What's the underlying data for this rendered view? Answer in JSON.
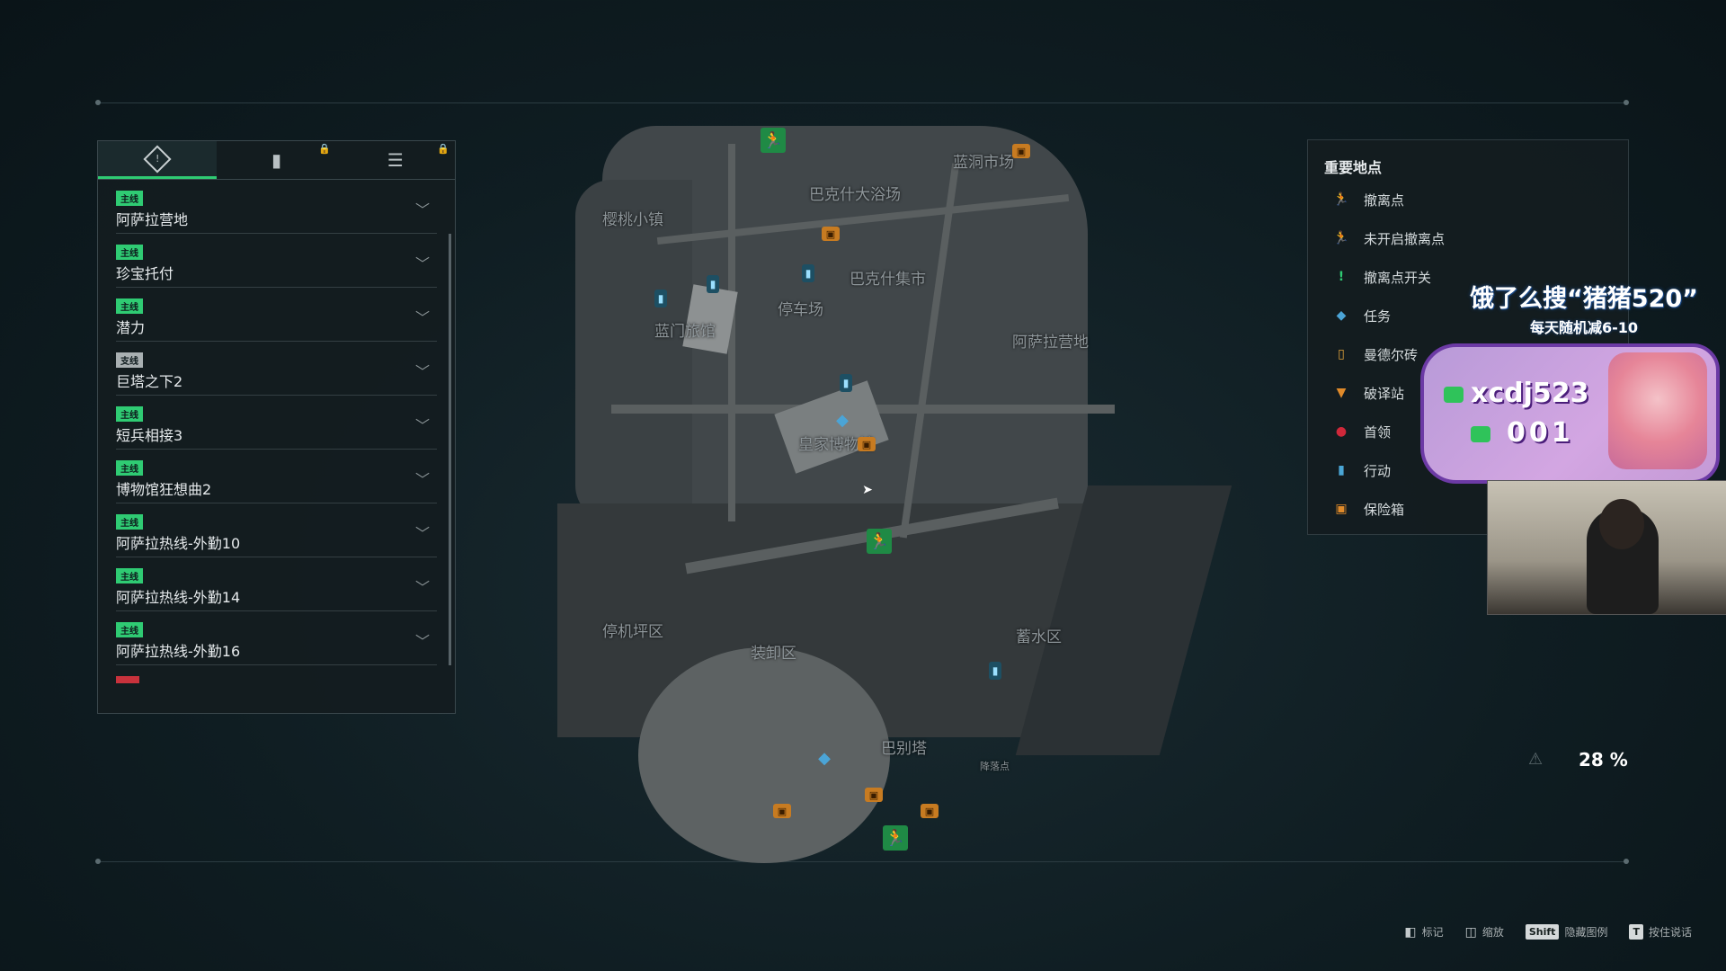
{
  "quest_panel": {
    "tabs": [
      {
        "icon": "quest-diamond-icon",
        "symbol": "!",
        "active": true
      },
      {
        "icon": "action-icon",
        "symbol": "▮",
        "locked": true
      },
      {
        "icon": "mail-icon",
        "symbol": "☰",
        "locked": true
      }
    ],
    "quests": [
      {
        "badge": "主线",
        "type": "main",
        "title": "阿萨拉营地"
      },
      {
        "badge": "主线",
        "type": "main",
        "title": "珍宝托付"
      },
      {
        "badge": "主线",
        "type": "main",
        "title": "潜力"
      },
      {
        "badge": "支线",
        "type": "side",
        "title": "巨塔之下2"
      },
      {
        "badge": "主线",
        "type": "main",
        "title": "短兵相接3"
      },
      {
        "badge": "主线",
        "type": "main",
        "title": "博物馆狂想曲2"
      },
      {
        "badge": "主线",
        "type": "main",
        "title": "阿萨拉热线-外勤10"
      },
      {
        "badge": "主线",
        "type": "main",
        "title": "阿萨拉热线-外勤14"
      },
      {
        "badge": "主线",
        "type": "main",
        "title": "阿萨拉热线-外勤16"
      }
    ]
  },
  "legend": {
    "title": "重要地点",
    "items": [
      {
        "label": "撤离点",
        "icon": "exit-icon",
        "color": "#2fcb73",
        "symbol": "🏃"
      },
      {
        "label": "未开启撤离点",
        "icon": "closed-exit-icon",
        "color": "#8c9598",
        "symbol": "🏃"
      },
      {
        "label": "撤离点开关",
        "icon": "exit-switch-icon",
        "color": "#2fcb73",
        "symbol": "!"
      },
      {
        "label": "任务",
        "icon": "task-icon",
        "color": "#4ba4d6",
        "symbol": "◆"
      },
      {
        "label": "曼德尔砖",
        "icon": "mandel-brick-icon",
        "color": "#e0a23a",
        "symbol": "▯"
      },
      {
        "label": "破译站",
        "icon": "decrypt-station-icon",
        "color": "#e08a2a",
        "symbol": "▼"
      },
      {
        "label": "首领",
        "icon": "boss-icon",
        "color": "#d0283a",
        "symbol": "●"
      },
      {
        "label": "行动",
        "icon": "action-icon",
        "color": "#4aa6d6",
        "symbol": "▮"
      },
      {
        "label": "保险箱",
        "icon": "safe-icon",
        "color": "#e08a2a",
        "symbol": "▣"
      }
    ]
  },
  "map": {
    "labels": [
      {
        "text": "巴克什大浴场"
      },
      {
        "text": "蓝洞市场"
      },
      {
        "text": "樱桃小镇"
      },
      {
        "text": "巴克什集市"
      },
      {
        "text": "停车场"
      },
      {
        "text": "蓝门旅馆"
      },
      {
        "text": "阿萨拉营地"
      },
      {
        "text": "皇家博物馆"
      },
      {
        "text": "停机坪区"
      },
      {
        "text": "装卸区"
      },
      {
        "text": "蓄水区"
      },
      {
        "text": "巴别塔"
      },
      {
        "text": "降落点"
      }
    ]
  },
  "overlay": {
    "promo_title": "饿了么搜“猪猪520”",
    "promo_sub": "每天随机减6-10",
    "card_id": "xcdj523",
    "card_num": "001"
  },
  "exploration": {
    "percent_label": "28 %",
    "percent": 28
  },
  "hints": [
    {
      "key": "",
      "icon": "mouse-icon",
      "label": "标记"
    },
    {
      "key": "",
      "icon": "scroll-icon",
      "label": "缩放"
    },
    {
      "key": "Shift",
      "icon": "",
      "label": "隐藏图例"
    },
    {
      "key": "T",
      "icon": "",
      "label": "按住说话"
    }
  ]
}
